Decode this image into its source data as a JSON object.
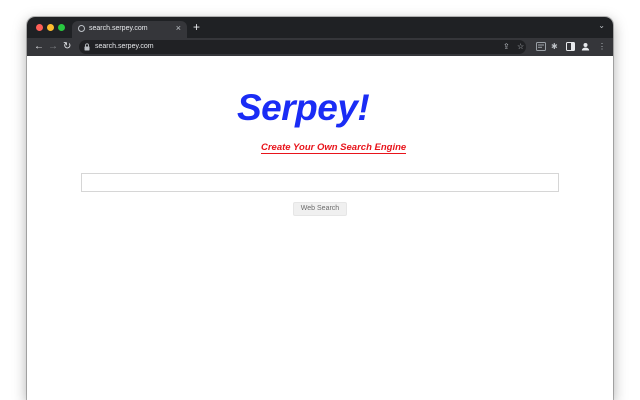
{
  "browser": {
    "tab": {
      "title": "search.serpey.com",
      "close": "×"
    },
    "new_tab": "+",
    "tab_search": "⌄",
    "nav": {
      "back": "←",
      "forward": "→",
      "reload": "↻"
    },
    "address": {
      "url": "search.serpey.com"
    },
    "toolbar_icons": {
      "share": "⇪",
      "star": "☆",
      "extensions": "✱",
      "more": "⋮"
    }
  },
  "page": {
    "logo": "Serpey!",
    "tagline": "Create Your Own Search Engine",
    "search": {
      "value": "",
      "placeholder": ""
    },
    "search_button": "Web Search"
  },
  "colors": {
    "logo": "#1a2cf5",
    "tagline": "#e8141b",
    "chrome_dark": "#35363a"
  }
}
